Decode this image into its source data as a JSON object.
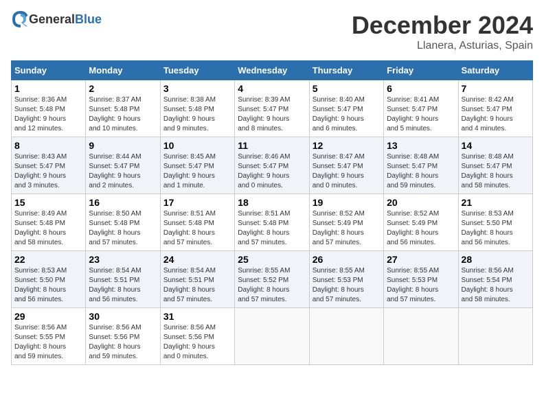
{
  "header": {
    "logo_general": "General",
    "logo_blue": "Blue",
    "month_title": "December 2024",
    "location": "Llanera, Asturias, Spain"
  },
  "weekdays": [
    "Sunday",
    "Monday",
    "Tuesday",
    "Wednesday",
    "Thursday",
    "Friday",
    "Saturday"
  ],
  "weeks": [
    [
      {
        "day": "1",
        "info": "Sunrise: 8:36 AM\nSunset: 5:48 PM\nDaylight: 9 hours\nand 12 minutes."
      },
      {
        "day": "2",
        "info": "Sunrise: 8:37 AM\nSunset: 5:48 PM\nDaylight: 9 hours\nand 10 minutes."
      },
      {
        "day": "3",
        "info": "Sunrise: 8:38 AM\nSunset: 5:48 PM\nDaylight: 9 hours\nand 9 minutes."
      },
      {
        "day": "4",
        "info": "Sunrise: 8:39 AM\nSunset: 5:47 PM\nDaylight: 9 hours\nand 8 minutes."
      },
      {
        "day": "5",
        "info": "Sunrise: 8:40 AM\nSunset: 5:47 PM\nDaylight: 9 hours\nand 6 minutes."
      },
      {
        "day": "6",
        "info": "Sunrise: 8:41 AM\nSunset: 5:47 PM\nDaylight: 9 hours\nand 5 minutes."
      },
      {
        "day": "7",
        "info": "Sunrise: 8:42 AM\nSunset: 5:47 PM\nDaylight: 9 hours\nand 4 minutes."
      }
    ],
    [
      {
        "day": "8",
        "info": "Sunrise: 8:43 AM\nSunset: 5:47 PM\nDaylight: 9 hours\nand 3 minutes."
      },
      {
        "day": "9",
        "info": "Sunrise: 8:44 AM\nSunset: 5:47 PM\nDaylight: 9 hours\nand 2 minutes."
      },
      {
        "day": "10",
        "info": "Sunrise: 8:45 AM\nSunset: 5:47 PM\nDaylight: 9 hours\nand 1 minute."
      },
      {
        "day": "11",
        "info": "Sunrise: 8:46 AM\nSunset: 5:47 PM\nDaylight: 9 hours\nand 0 minutes."
      },
      {
        "day": "12",
        "info": "Sunrise: 8:47 AM\nSunset: 5:47 PM\nDaylight: 9 hours\nand 0 minutes."
      },
      {
        "day": "13",
        "info": "Sunrise: 8:48 AM\nSunset: 5:47 PM\nDaylight: 8 hours\nand 59 minutes."
      },
      {
        "day": "14",
        "info": "Sunrise: 8:48 AM\nSunset: 5:47 PM\nDaylight: 8 hours\nand 58 minutes."
      }
    ],
    [
      {
        "day": "15",
        "info": "Sunrise: 8:49 AM\nSunset: 5:48 PM\nDaylight: 8 hours\nand 58 minutes."
      },
      {
        "day": "16",
        "info": "Sunrise: 8:50 AM\nSunset: 5:48 PM\nDaylight: 8 hours\nand 57 minutes."
      },
      {
        "day": "17",
        "info": "Sunrise: 8:51 AM\nSunset: 5:48 PM\nDaylight: 8 hours\nand 57 minutes."
      },
      {
        "day": "18",
        "info": "Sunrise: 8:51 AM\nSunset: 5:48 PM\nDaylight: 8 hours\nand 57 minutes."
      },
      {
        "day": "19",
        "info": "Sunrise: 8:52 AM\nSunset: 5:49 PM\nDaylight: 8 hours\nand 57 minutes."
      },
      {
        "day": "20",
        "info": "Sunrise: 8:52 AM\nSunset: 5:49 PM\nDaylight: 8 hours\nand 56 minutes."
      },
      {
        "day": "21",
        "info": "Sunrise: 8:53 AM\nSunset: 5:50 PM\nDaylight: 8 hours\nand 56 minutes."
      }
    ],
    [
      {
        "day": "22",
        "info": "Sunrise: 8:53 AM\nSunset: 5:50 PM\nDaylight: 8 hours\nand 56 minutes."
      },
      {
        "day": "23",
        "info": "Sunrise: 8:54 AM\nSunset: 5:51 PM\nDaylight: 8 hours\nand 56 minutes."
      },
      {
        "day": "24",
        "info": "Sunrise: 8:54 AM\nSunset: 5:51 PM\nDaylight: 8 hours\nand 57 minutes."
      },
      {
        "day": "25",
        "info": "Sunrise: 8:55 AM\nSunset: 5:52 PM\nDaylight: 8 hours\nand 57 minutes."
      },
      {
        "day": "26",
        "info": "Sunrise: 8:55 AM\nSunset: 5:53 PM\nDaylight: 8 hours\nand 57 minutes."
      },
      {
        "day": "27",
        "info": "Sunrise: 8:55 AM\nSunset: 5:53 PM\nDaylight: 8 hours\nand 57 minutes."
      },
      {
        "day": "28",
        "info": "Sunrise: 8:56 AM\nSunset: 5:54 PM\nDaylight: 8 hours\nand 58 minutes."
      }
    ],
    [
      {
        "day": "29",
        "info": "Sunrise: 8:56 AM\nSunset: 5:55 PM\nDaylight: 8 hours\nand 59 minutes."
      },
      {
        "day": "30",
        "info": "Sunrise: 8:56 AM\nSunset: 5:56 PM\nDaylight: 8 hours\nand 59 minutes."
      },
      {
        "day": "31",
        "info": "Sunrise: 8:56 AM\nSunset: 5:56 PM\nDaylight: 9 hours\nand 0 minutes."
      },
      {
        "day": "",
        "info": ""
      },
      {
        "day": "",
        "info": ""
      },
      {
        "day": "",
        "info": ""
      },
      {
        "day": "",
        "info": ""
      }
    ]
  ]
}
